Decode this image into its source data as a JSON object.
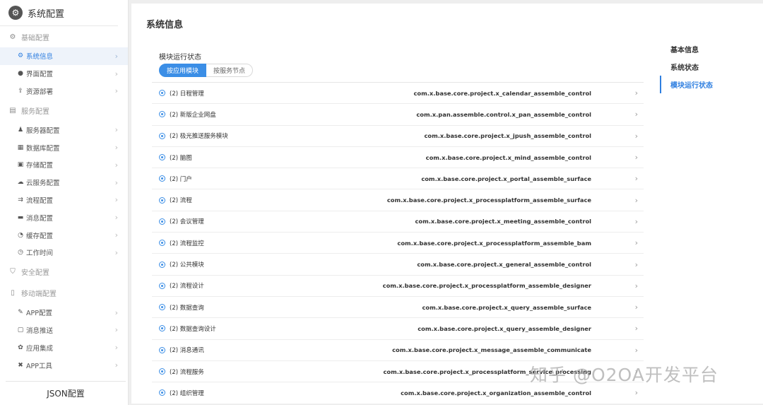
{
  "sidebar": {
    "title": "系统配置",
    "footer": "JSON配置",
    "sections": [
      {
        "label": "基础配置",
        "icon": "gear-icon",
        "items": [
          {
            "label": "系统信息",
            "icon": "gear-small-icon",
            "active": true
          },
          {
            "label": "界面配置",
            "icon": "palette-icon"
          },
          {
            "label": "资源部署",
            "icon": "deploy-icon"
          }
        ]
      },
      {
        "label": "服务配置",
        "icon": "server-group-icon",
        "items": [
          {
            "label": "服务器配置",
            "icon": "user-server-icon"
          },
          {
            "label": "数据库配置",
            "icon": "database-icon"
          },
          {
            "label": "存储配置",
            "icon": "storage-icon"
          },
          {
            "label": "云服务配置",
            "icon": "cloud-icon"
          },
          {
            "label": "流程配置",
            "icon": "flow-icon"
          },
          {
            "label": "消息配置",
            "icon": "message-icon"
          },
          {
            "label": "缓存配置",
            "icon": "cache-icon"
          },
          {
            "label": "工作时间",
            "icon": "clock-icon"
          }
        ]
      },
      {
        "label": "安全配置",
        "icon": "shield-icon",
        "items": []
      },
      {
        "label": "移动端配置",
        "icon": "mobile-icon",
        "items": [
          {
            "label": "APP配置",
            "icon": "app-icon"
          },
          {
            "label": "消息推送",
            "icon": "push-icon"
          },
          {
            "label": "应用集成",
            "icon": "integration-icon"
          },
          {
            "label": "APP工具",
            "icon": "tools-icon"
          }
        ]
      }
    ]
  },
  "main": {
    "title": "系统信息",
    "section_title": "模块运行状态",
    "tabs": [
      "按应用模块",
      "按服务节点"
    ],
    "rows": [
      {
        "name": "(2) 日程管理",
        "class": "com.x.base.core.project.x_calendar_assemble_control"
      },
      {
        "name": "(2) 新版企业网盘",
        "class": "com.x.pan.assemble.control.x_pan_assemble_control"
      },
      {
        "name": "(2) 极光推送服务模块",
        "class": "com.x.base.core.project.x_jpush_assemble_control"
      },
      {
        "name": "(2) 脑图",
        "class": "com.x.base.core.project.x_mind_assemble_control"
      },
      {
        "name": "(2) 门户",
        "class": "com.x.base.core.project.x_portal_assemble_surface"
      },
      {
        "name": "(2) 流程",
        "class": "com.x.base.core.project.x_processplatform_assemble_surface"
      },
      {
        "name": "(2) 会议管理",
        "class": "com.x.base.core.project.x_meeting_assemble_control"
      },
      {
        "name": "(2) 流程监控",
        "class": "com.x.base.core.project.x_processplatform_assemble_bam"
      },
      {
        "name": "(2) 公共模块",
        "class": "com.x.base.core.project.x_general_assemble_control"
      },
      {
        "name": "(2) 流程设计",
        "class": "com.x.base.core.project.x_processplatform_assemble_designer"
      },
      {
        "name": "(2) 数据查询",
        "class": "com.x.base.core.project.x_query_assemble_surface"
      },
      {
        "name": "(2) 数据查询设计",
        "class": "com.x.base.core.project.x_query_assemble_designer"
      },
      {
        "name": "(2) 消息通讯",
        "class": "com.x.base.core.project.x_message_assemble_communicate"
      },
      {
        "name": "(2) 流程服务",
        "class": "com.x.base.core.project.x_processplatform_service_processing"
      },
      {
        "name": "(2) 组织管理",
        "class": "com.x.base.core.project.x_organization_assemble_control"
      }
    ]
  },
  "right_nav": {
    "items": [
      {
        "label": "基本信息"
      },
      {
        "label": "系统状态"
      },
      {
        "label": "模块运行状态",
        "active": true
      }
    ]
  },
  "watermark": "知乎 @O2OA开发平台",
  "colors": {
    "accent": "#2f7fe0",
    "active_bg": "#eef3fa"
  }
}
